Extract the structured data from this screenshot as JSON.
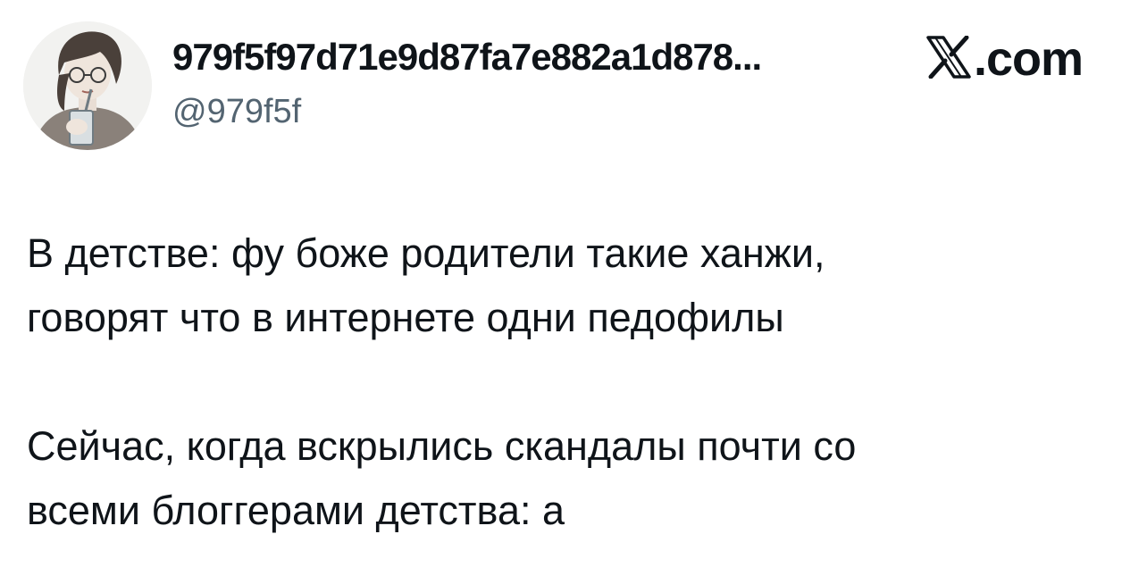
{
  "author": {
    "display_name": "979f5f97d71e9d87fa7e882a1d878...",
    "handle": "@979f5f",
    "avatar_icon": "drawn-person-with-drink-avatar"
  },
  "brand": {
    "icon": "x-logo-icon",
    "text": ".com"
  },
  "tweet": {
    "paragraphs": [
      {
        "line1": "В детстве: фу боже родители такие ханжи,",
        "line2": "говорят что в интернете одни педофилы"
      },
      {
        "line1": "Сейчас, когда вскрылись скандалы почти со",
        "line2": "всеми блоггерами детства: а"
      }
    ]
  },
  "colors": {
    "text": "#0f1419",
    "secondary": "#536471",
    "background": "#ffffff"
  }
}
